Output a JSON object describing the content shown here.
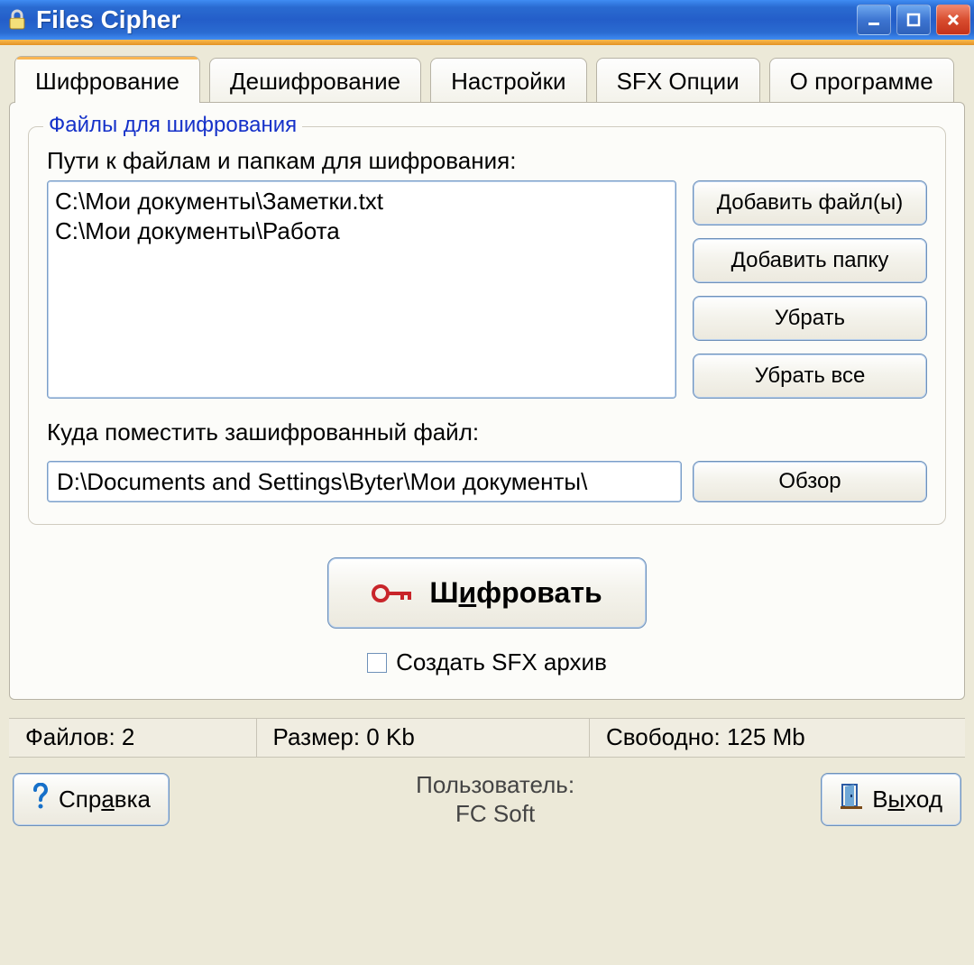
{
  "window": {
    "title": "Files Cipher"
  },
  "tabs": [
    {
      "label": "Шифрование",
      "active": true
    },
    {
      "label": "Дешифрование",
      "active": false
    },
    {
      "label": "Настройки",
      "active": false
    },
    {
      "label": "SFX Опции",
      "active": false
    },
    {
      "label": "О программе",
      "active": false
    }
  ],
  "group": {
    "legend": "Файлы для шифрования",
    "paths_label": "Пути к файлам и папкам для шифрования:",
    "paths": [
      "C:\\Мои документы\\Заметки.txt",
      "C:\\Мои документы\\Работа"
    ],
    "buttons": {
      "add_files": "Добавить файл(ы)",
      "add_folder": "Добавить папку",
      "remove": "Убрать",
      "remove_all": "Убрать все"
    },
    "dest_label": "Куда поместить зашифрованный файл:",
    "dest_value": "D:\\Documents and Settings\\Byter\\Мои документы\\",
    "browse": "Обзор"
  },
  "encrypt": {
    "pre": "Ш",
    "u": "и",
    "post": "фровать"
  },
  "sfx_label": "Создать SFX архив",
  "status": {
    "files": "Файлов: 2",
    "size": "Размер: 0 Kb",
    "free": "Свободно: 125 Mb"
  },
  "help": {
    "pre": "Спр",
    "u": "а",
    "post": "вка"
  },
  "user_block": {
    "title": "Пользователь:",
    "name": "FC Soft"
  },
  "exit": {
    "pre": "В",
    "u": "ы",
    "post": "ход"
  }
}
